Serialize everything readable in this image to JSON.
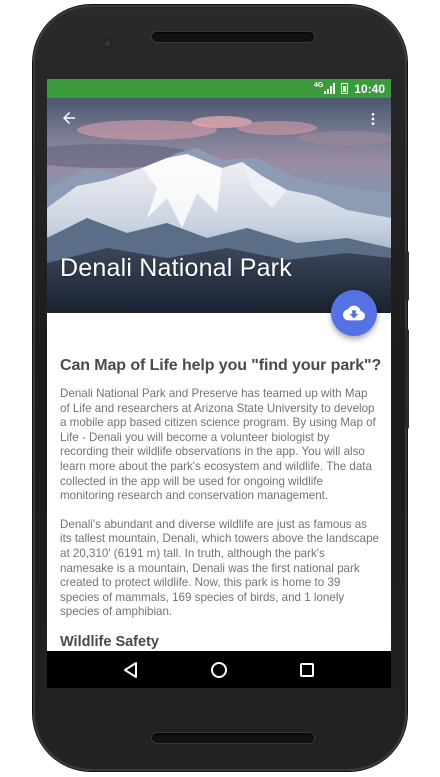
{
  "status_bar": {
    "network": "4G",
    "time": "10:40",
    "background": "#3a9a3c"
  },
  "toolbar": {
    "back_icon": "arrow-back-icon",
    "menu_icon": "more-vert-icon"
  },
  "hero": {
    "title": "Denali National Park"
  },
  "fab": {
    "icon": "cloud-download-icon",
    "color": "#5472e4"
  },
  "content": {
    "heading": "Can Map of Life help you \"find your park\"?",
    "paragraphs": [
      "Denali National Park and Preserve has teamed up with Map of Life and researchers at Arizona State University to develop a mobile app based citizen science program. By using Map of Life - Denali you will become a volunteer biologist by recording their wildlife observations in the app. You will also learn more about the park's ecosystem and wildlife. The data collected in the app will be used for ongoing wildlife monitoring research and conservation management.",
      "Denali's abundant and diverse wildlife are just as famous as its tallest mountain, Denali, which towers above the landscape at 20,310' (6191 m) tall. In truth, although the park's namesake is a mountain, Denali was the first national park created to protect wildlife. Now, this park is home to 39 species of mammals, 169 species of birds, and 1 lonely species of amphibian."
    ],
    "subheading": "Wildlife Safety"
  },
  "nav_bar": {
    "back": "nav-back-icon",
    "home": "nav-home-icon",
    "recents": "nav-recents-icon"
  }
}
